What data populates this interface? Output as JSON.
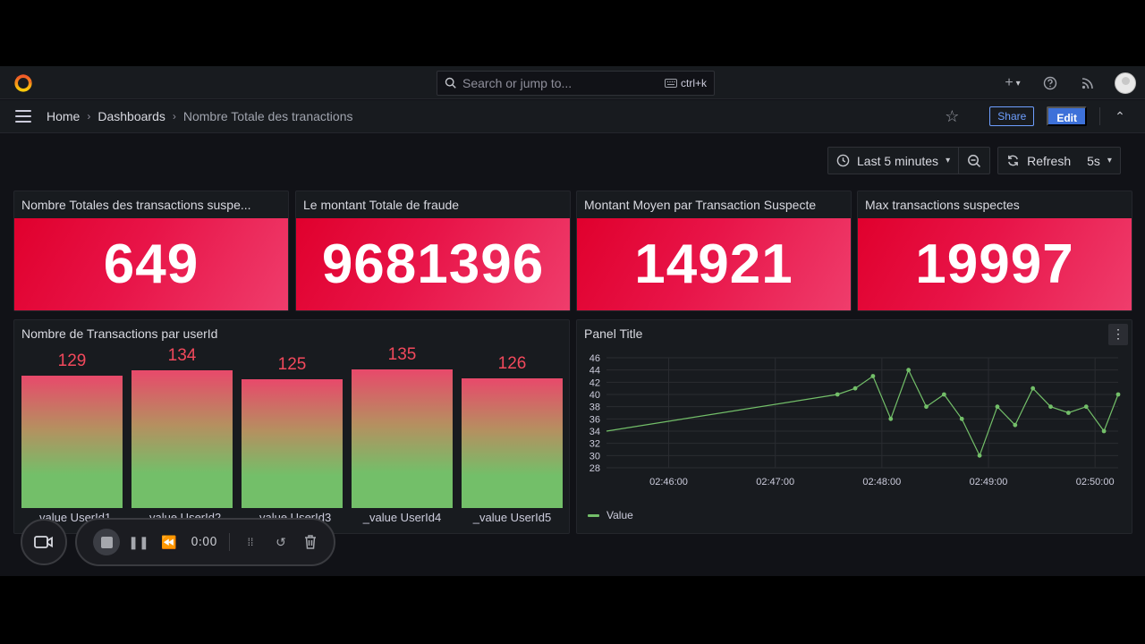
{
  "topbar": {
    "search_placeholder": "Search or jump to...",
    "search_shortcut": "ctrl+k"
  },
  "breadcrumb": {
    "home": "Home",
    "dashboards": "Dashboards",
    "current": "Nombre Totale des tranactions"
  },
  "actions": {
    "share": "Share",
    "edit": "Edit"
  },
  "time": {
    "range": "Last 5 minutes",
    "refresh_label": "Refresh",
    "interval": "5s"
  },
  "stats": [
    {
      "title": "Nombre Totales des transactions suspe...",
      "value": "649"
    },
    {
      "title": "Le montant Totale de fraude",
      "value": "9681396"
    },
    {
      "title": "Montant Moyen par Transaction Suspecte",
      "value": "14921"
    },
    {
      "title": "Max transactions suspectes",
      "value": "19997"
    }
  ],
  "bargauge": {
    "title": "Nombre de Transactions par userId",
    "bars": [
      {
        "label": "_value UserId1",
        "value": 129
      },
      {
        "label": "_value UserId2",
        "value": 134
      },
      {
        "label": "_value UserId3",
        "value": 125
      },
      {
        "label": "_value UserId4",
        "value": 135
      },
      {
        "label": "_value UserId5",
        "value": 126
      }
    ]
  },
  "timeseries": {
    "title": "Panel Title",
    "legend": "Value",
    "colors": {
      "line": "#73bf69"
    }
  },
  "chart_data": {
    "type": "line",
    "title": "Panel Title",
    "xlabel": "",
    "ylabel": "",
    "ylim": [
      28,
      46
    ],
    "y_ticks": [
      28,
      30,
      32,
      34,
      36,
      38,
      40,
      42,
      44,
      46
    ],
    "x_ticks": [
      "02:46:00",
      "02:47:00",
      "02:48:00",
      "02:49:00",
      "02:50:00"
    ],
    "xlim": [
      "02:45:25",
      "02:50:13"
    ],
    "grid": true,
    "legend": "bottom-left",
    "series": [
      {
        "name": "Value",
        "x": [
          "02:45:25",
          "02:47:35",
          "02:47:45",
          "02:47:55",
          "02:48:05",
          "02:48:15",
          "02:48:25",
          "02:48:35",
          "02:48:45",
          "02:48:55",
          "02:49:05",
          "02:49:15",
          "02:49:25",
          "02:49:35",
          "02:49:45",
          "02:49:55",
          "02:50:05",
          "02:50:13"
        ],
        "values": [
          34,
          40,
          41,
          43,
          36,
          44,
          38,
          40,
          36,
          30,
          38,
          35,
          41,
          38,
          37,
          38,
          34,
          40
        ]
      }
    ]
  },
  "recorder": {
    "time": "0:00"
  }
}
